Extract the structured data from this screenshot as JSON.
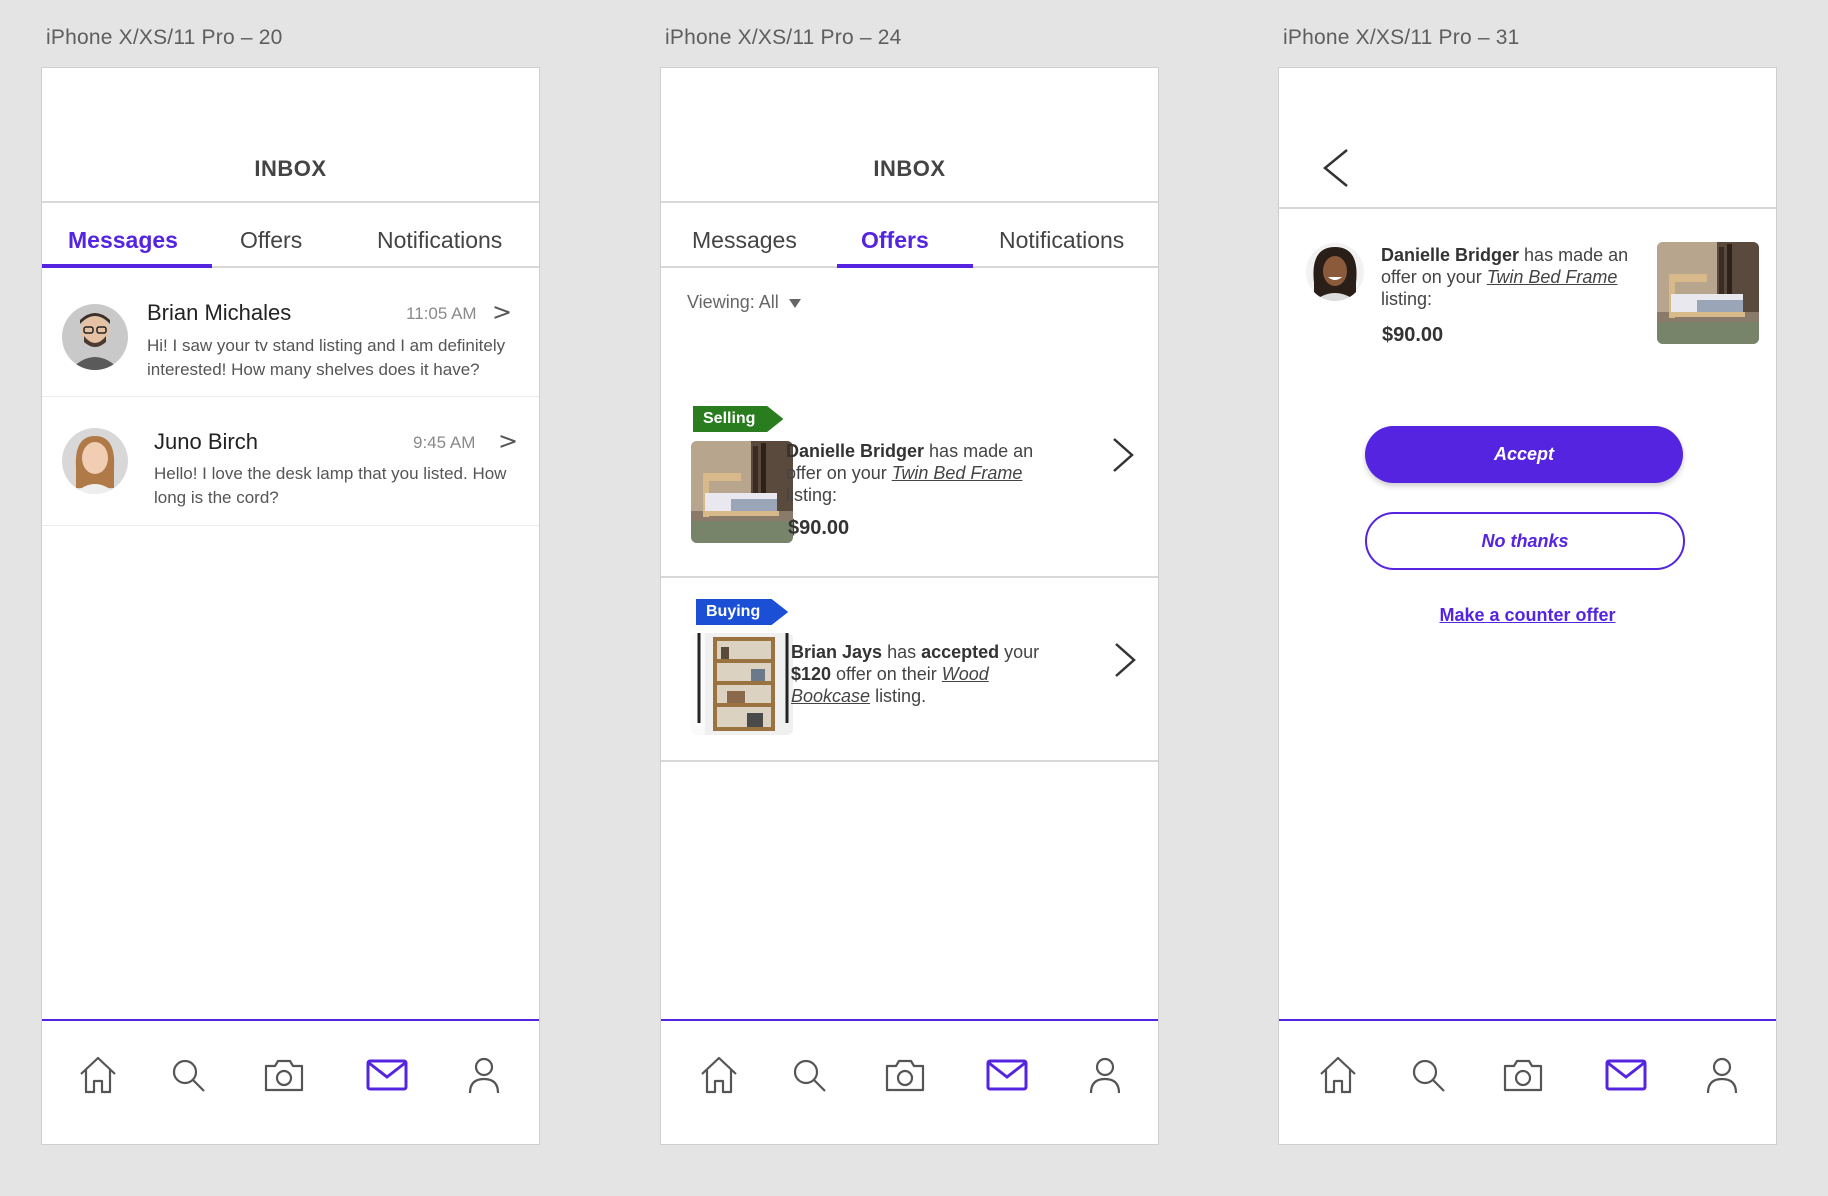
{
  "artboards": [
    {
      "label": "iPhone X/XS/11 Pro – 20"
    },
    {
      "label": "iPhone X/XS/11 Pro – 24"
    },
    {
      "label": "iPhone X/XS/11 Pro – 31"
    }
  ],
  "inbox": {
    "title": "INBOX"
  },
  "tabs": {
    "messages": "Messages",
    "offers": "Offers",
    "notifications": "Notifications"
  },
  "messages": [
    {
      "name": "Brian Michales",
      "time": "11:05 AM",
      "text": "Hi! I saw your tv stand listing and I am definitely interested! How many shelves does it have?"
    },
    {
      "name": "Juno Birch",
      "time": "9:45 AM",
      "text": "Hello! I love the desk lamp that you listed. How long is the cord?"
    }
  ],
  "offers": {
    "viewing_label": "Viewing: All",
    "items": [
      {
        "tag": "Selling",
        "user": "Danielle Bridger",
        "text_1": " has made an offer on your ",
        "listing": "Twin Bed Frame",
        "text_2": " listing:",
        "price": "$90.00"
      },
      {
        "tag": "Buying",
        "user": "Brian Jays",
        "text_1": " has ",
        "accepted": "accepted",
        "text_2": " your ",
        "amount": "$120",
        "text_3": " offer on their ",
        "listing": "Wood Bookcase",
        "text_4": " listing."
      }
    ]
  },
  "detail": {
    "user": "Danielle Bridger",
    "text_1": " has made an offer on your ",
    "listing": "Twin Bed Frame",
    "text_2": " listing:",
    "price": "$90.00",
    "accept_label": "Accept",
    "decline_label": "No thanks",
    "counter_label": "Make a counter offer"
  },
  "nav": {
    "icons": [
      "home-icon",
      "search-icon",
      "camera-icon",
      "mail-icon",
      "profile-icon"
    ],
    "active": "mail-icon"
  },
  "colors": {
    "accent": "#5424e0",
    "selling_tag": "#2a7d1f",
    "buying_tag": "#1a4fd6",
    "background": "#e4e4e4"
  }
}
